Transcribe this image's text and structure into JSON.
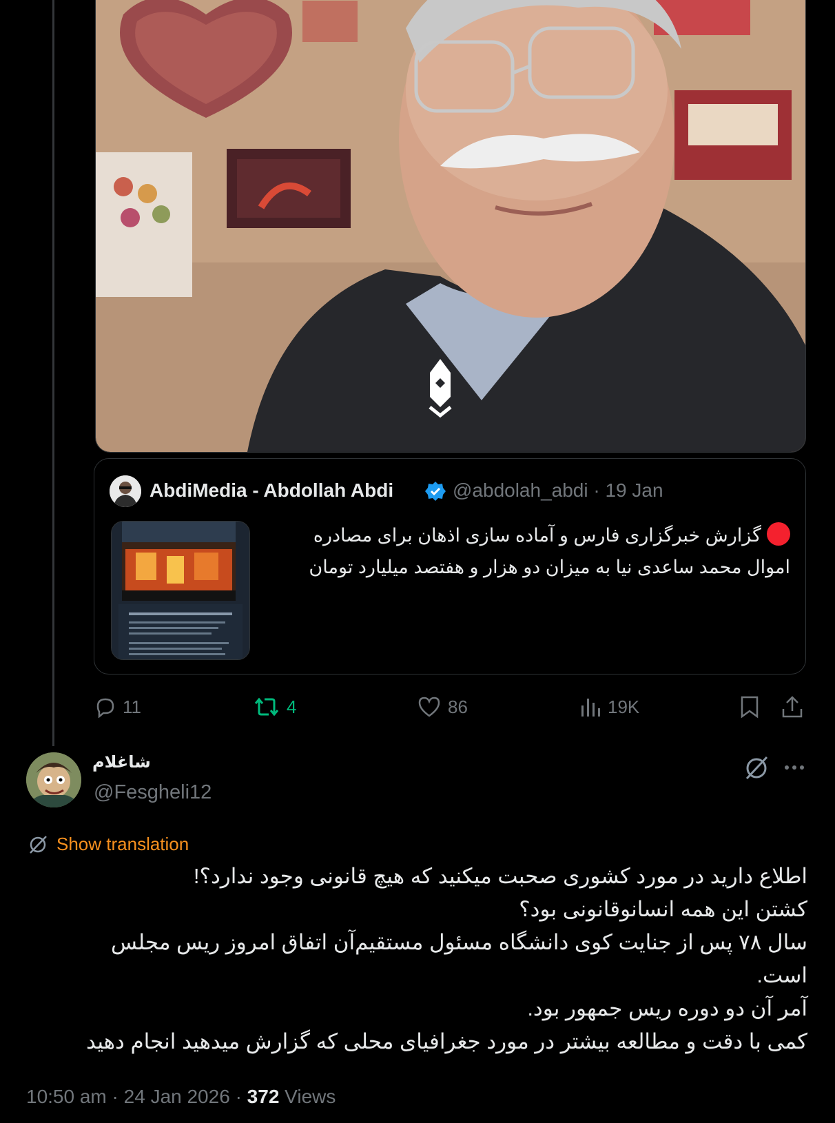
{
  "main_image": {
    "description_icon": "video-logo-icon"
  },
  "quoted_tweet": {
    "display_name": "AbdiMedia - Abdollah Abdi",
    "handle": "@abdolah_abdi",
    "separator": "·",
    "date": "19 Jan",
    "text_line_1": "گزارش خبرگزاری فارس و آماده سازی اذهان برای مصادره",
    "text_line_2": "اموال محمد ساعدی نیا به میزان دو هزار و هفتصد میلیارد تومان",
    "thumbnail_title": "اموال ساعدی‌نیا برابر با خسارت اغتشاشات در تهران"
  },
  "actions": {
    "replies": "11",
    "reposts": "4",
    "likes": "86",
    "views": "19K"
  },
  "colors": {
    "repost_green": "#00ba7c",
    "translate_orange": "#f7901e",
    "verified_blue": "#1d9bf0",
    "red_dot": "#f4212e"
  },
  "reply": {
    "display_name": "شاغلام",
    "handle": "@Fesgheli12",
    "translate_label": "Show translation",
    "lines": [
      "اطلاع دارید در مورد کشوری صحبت میکنید که هیچ قانونی وجود ندارد؟!",
      "کشتن این همه انسانوقانونی بود؟",
      "سال ۷۸ پس از جنایت کوی دانشگاه مسئول مستقیم‌آن اتفاق امروز ریس مجلس",
      "است.",
      "آمر آن دو دوره ریس جمهور بود.",
      "کمی با دقت و مطالعه بیشتر در مورد جغرافیای محلی که گزارش میدهید انجام دهید"
    ],
    "time": "10:50 am",
    "dot": "·",
    "date": "24 Jan 2026",
    "views_count": "372",
    "views_label": "Views"
  }
}
